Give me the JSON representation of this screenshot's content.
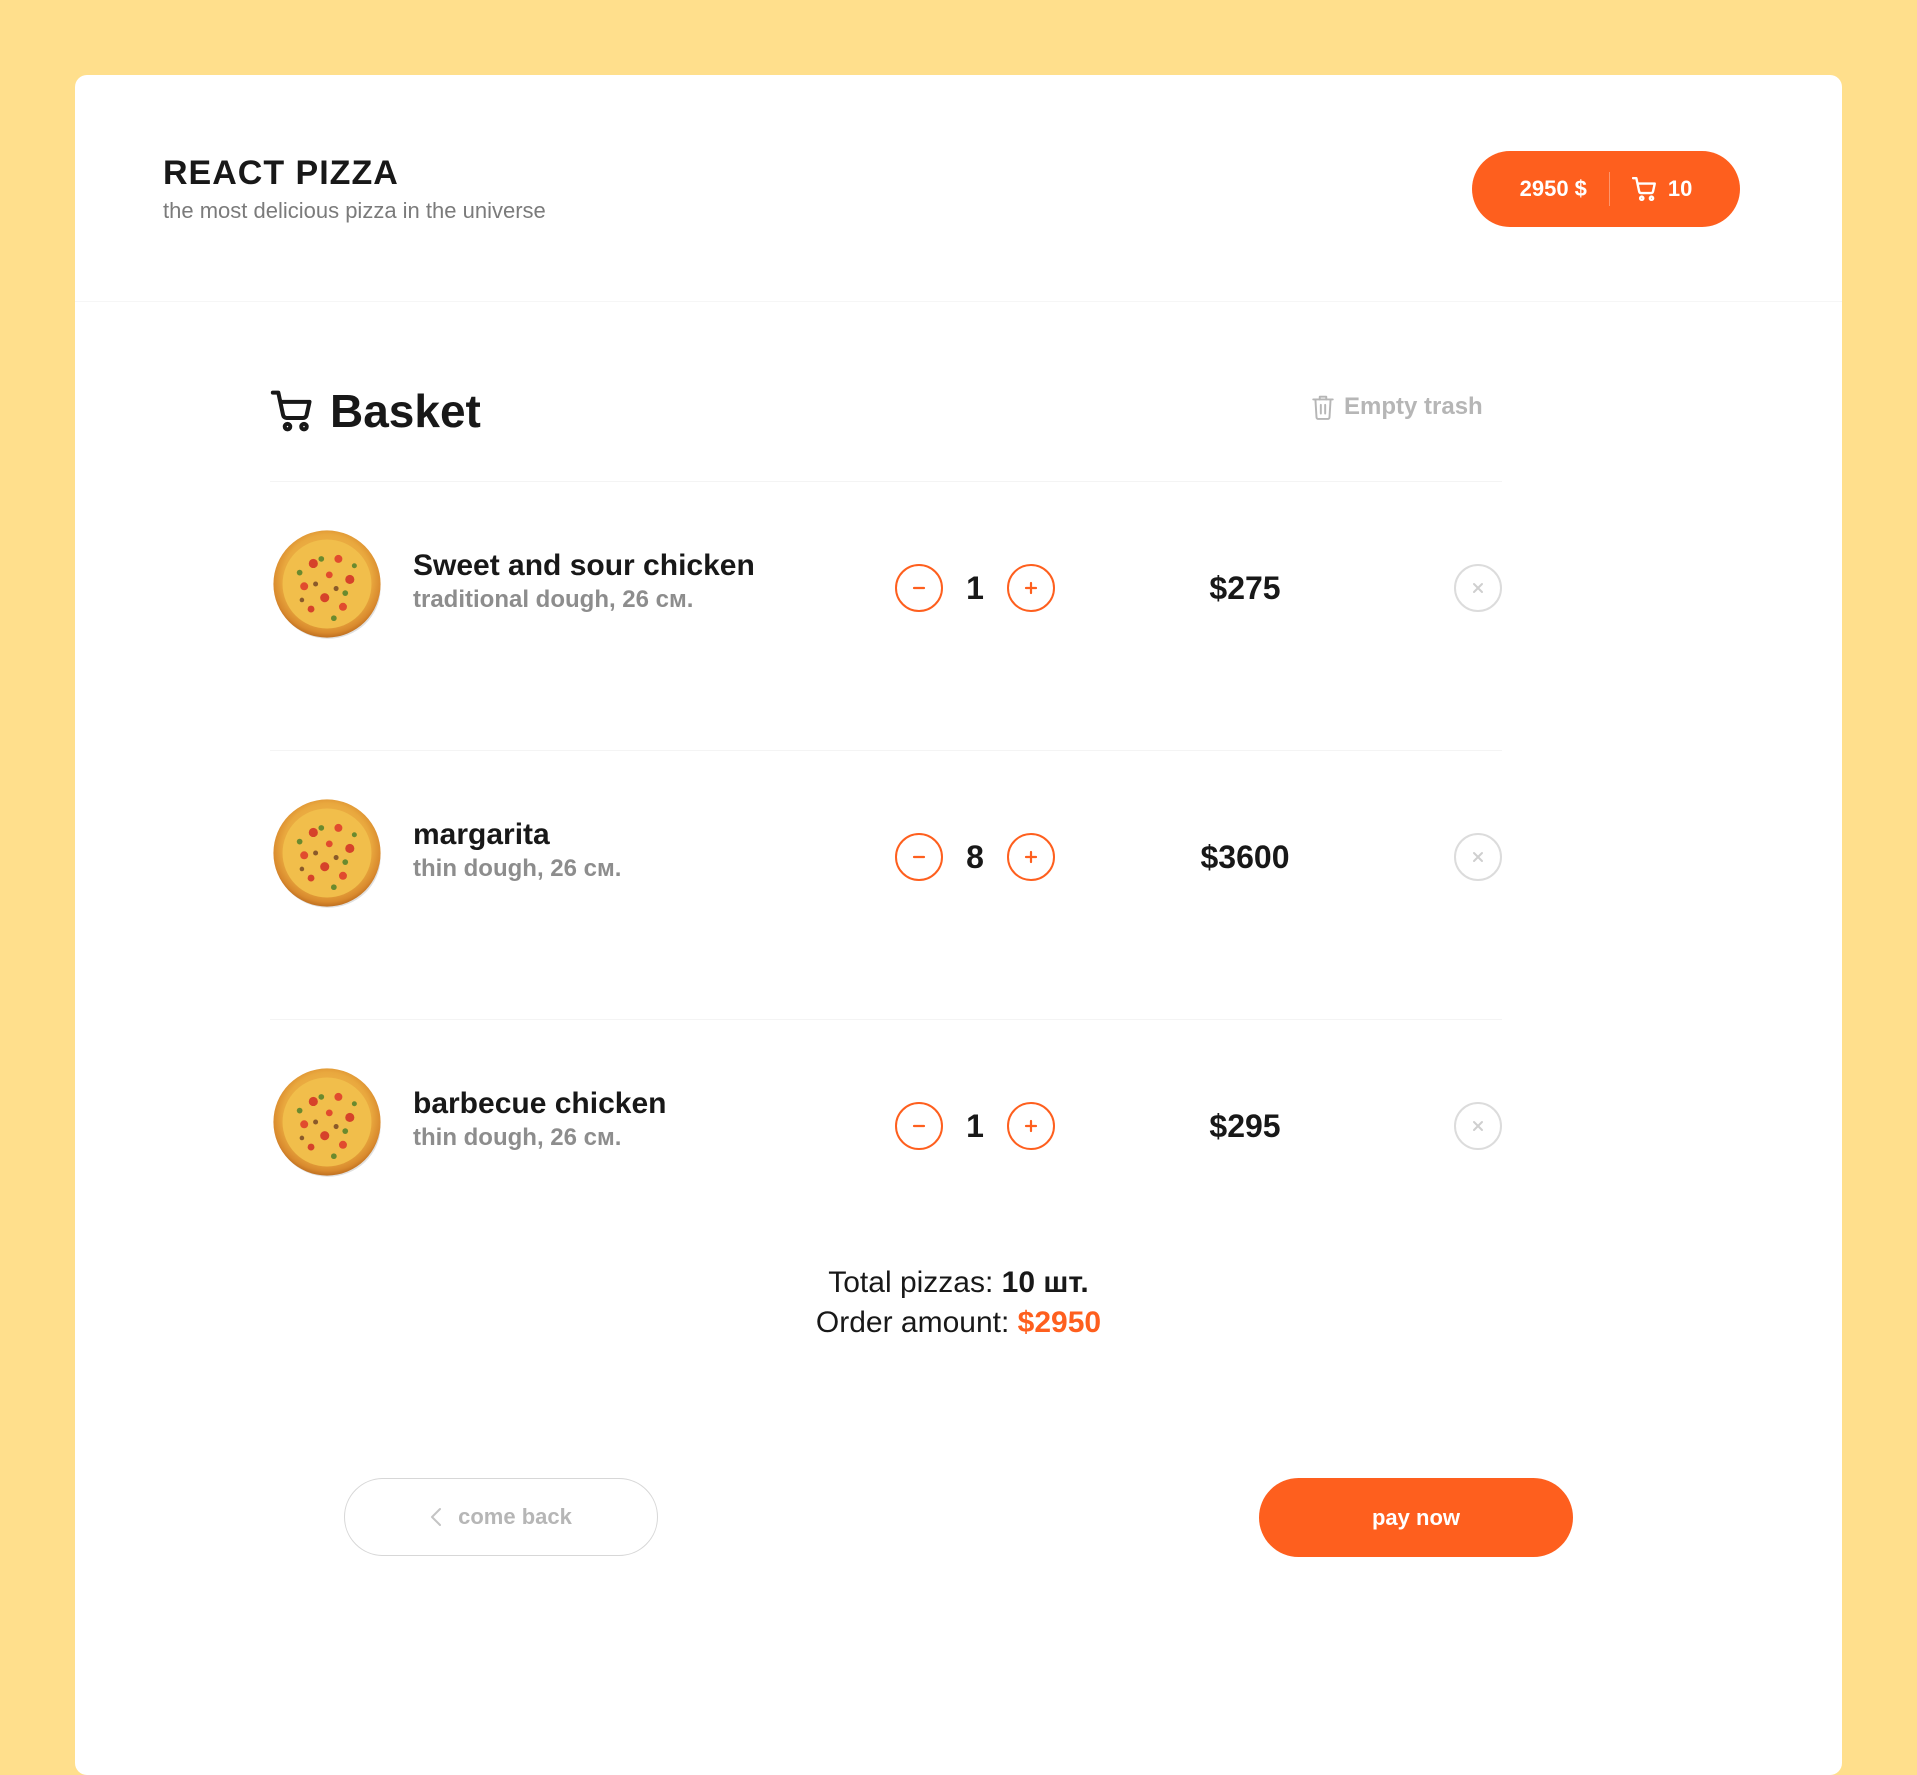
{
  "header": {
    "logo_title": "REACT PIZZA",
    "logo_subtitle": "the most delicious pizza in the universe",
    "cart_price": "2950 $",
    "cart_count": "10",
    "cart_icon": "cart-icon"
  },
  "basket": {
    "title": "Basket",
    "title_icon": "cart-icon",
    "empty_trash_label": "Empty trash",
    "empty_trash_icon": "trash-icon",
    "items": [
      {
        "name": "Sweet and sour chicken",
        "desc": "traditional dough, 26 см.",
        "qty": "1",
        "price": "$275"
      },
      {
        "name": "margarita",
        "desc": "thin dough, 26 см.",
        "qty": "8",
        "price": "$3600"
      },
      {
        "name": "barbecue chicken",
        "desc": "thin dough, 26 см.",
        "qty": "1",
        "price": "$295"
      }
    ]
  },
  "totals": {
    "pizzas_label": "Total pizzas:",
    "pizzas_value": "10 шт.",
    "amount_label": "Order amount:",
    "amount_value": "$2950"
  },
  "actions": {
    "back_label": "come back",
    "pay_label": "pay now"
  },
  "colors": {
    "page_background": "#FFDF8C",
    "accent": "#FE5F1E",
    "card_background": "#FFFFFF",
    "muted_text": "#B6B6B6"
  }
}
